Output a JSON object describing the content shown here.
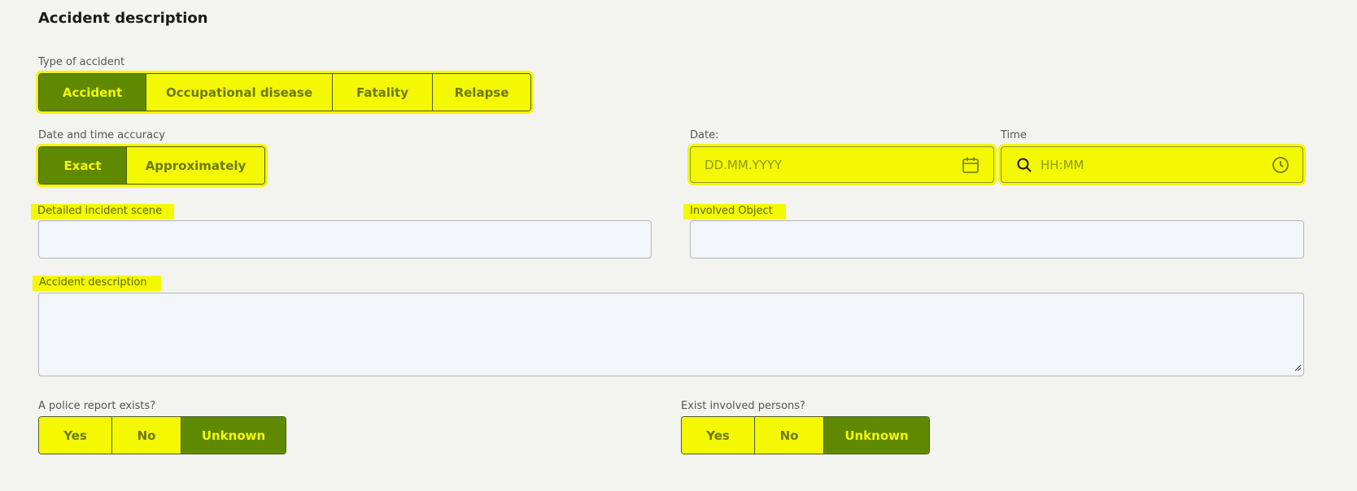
{
  "section_title": "Accident description",
  "type_of_accident": {
    "label": "Type of accident",
    "options": [
      "Accident",
      "Occupational disease",
      "Fatality",
      "Relapse"
    ],
    "selected": "Accident"
  },
  "accuracy": {
    "label": "Date and time accuracy",
    "options": [
      "Exact",
      "Approximately"
    ],
    "selected": "Exact"
  },
  "date": {
    "label": "Date:",
    "placeholder": "DD.MM.YYYY"
  },
  "time": {
    "label": "Time",
    "placeholder": "HH:MM"
  },
  "incident_scene": {
    "label": "Detailed incident scene",
    "value": ""
  },
  "involved_object": {
    "label": "Involved Object",
    "value": ""
  },
  "description": {
    "label": "Accident description",
    "value": ""
  },
  "police_report": {
    "label": "A police report exists?",
    "options": [
      "Yes",
      "No",
      "Unknown"
    ],
    "selected": "Unknown"
  },
  "involved_persons": {
    "label": "Exist involved persons?",
    "options": [
      "Yes",
      "No",
      "Unknown"
    ],
    "selected": "Unknown"
  },
  "colors": {
    "highlight": "#f4f800",
    "active": "#5f8a00",
    "field_bg": "#f3f6f8",
    "page_bg": "#f3f3ef"
  }
}
